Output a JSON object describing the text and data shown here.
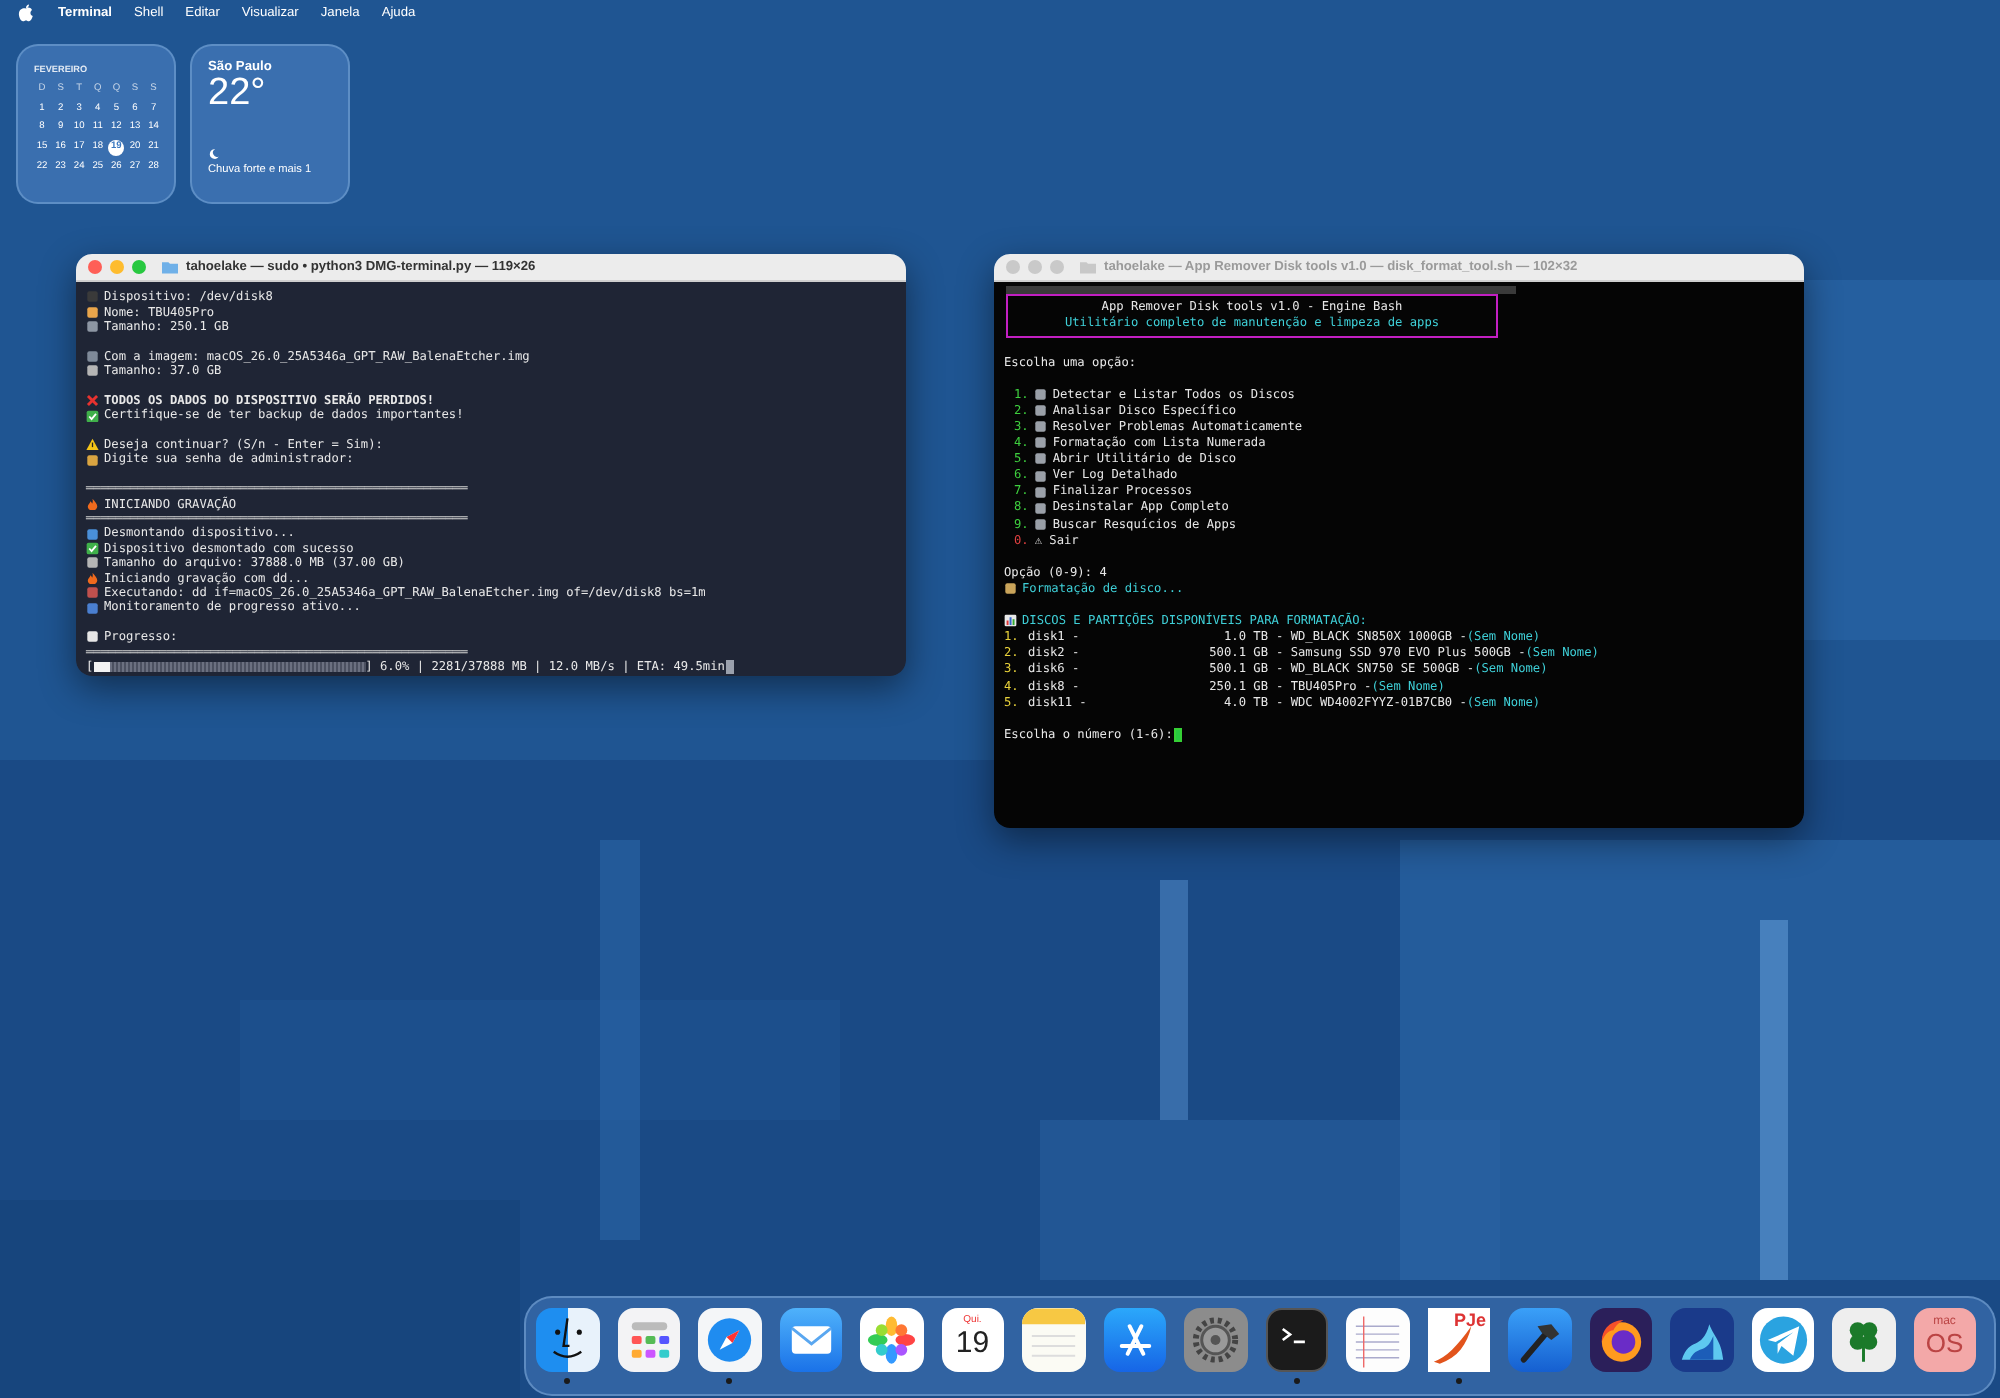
{
  "menu_bar": {
    "items": [
      {
        "label": "Terminal",
        "kind": "app"
      },
      {
        "label": "Shell",
        "kind": "menu"
      },
      {
        "label": "Editar",
        "kind": "menu"
      },
      {
        "label": "Visualizar",
        "kind": "menu"
      },
      {
        "label": "Janela",
        "kind": "menu"
      },
      {
        "label": "Ajuda",
        "kind": "menu"
      }
    ]
  },
  "calendar_widget": {
    "month": "FEVEREIRO",
    "weekdays": [
      "D",
      "S",
      "T",
      "Q",
      "Q",
      "S",
      "S"
    ],
    "weeks": [
      [
        {
          "day": "1",
          "selected": false
        },
        {
          "day": "2",
          "selected": false
        },
        {
          "day": "3",
          "selected": false
        },
        {
          "day": "4",
          "selected": false
        },
        {
          "day": "5",
          "selected": false
        },
        {
          "day": "6",
          "selected": false
        },
        {
          "day": "7",
          "selected": false
        }
      ],
      [
        {
          "day": "8",
          "selected": false
        },
        {
          "day": "9",
          "selected": false
        },
        {
          "day": "10",
          "selected": false
        },
        {
          "day": "11",
          "selected": false
        },
        {
          "day": "12",
          "selected": false
        },
        {
          "day": "13",
          "selected": false
        },
        {
          "day": "14",
          "selected": false
        }
      ],
      [
        {
          "day": "15",
          "selected": false
        },
        {
          "day": "16",
          "selected": false
        },
        {
          "day": "17",
          "selected": false
        },
        {
          "day": "18",
          "selected": false
        },
        {
          "day": "19",
          "selected": true
        },
        {
          "day": "20",
          "selected": false
        },
        {
          "day": "21",
          "selected": false
        }
      ],
      [
        {
          "day": "22",
          "selected": false
        },
        {
          "day": "23",
          "selected": false
        },
        {
          "day": "24",
          "selected": false
        },
        {
          "day": "25",
          "selected": false
        },
        {
          "day": "26",
          "selected": false
        },
        {
          "day": "27",
          "selected": false
        },
        {
          "day": "28",
          "selected": false
        }
      ]
    ]
  },
  "weather_widget": {
    "city": "São Paulo",
    "temperature": "22°",
    "condition": "Chuva forte e mais 1"
  },
  "dmg_terminal": {
    "title": "tahoelake — sudo • python3 DMG-terminal.py — 119×26",
    "active": true,
    "lines": [
      {
        "kind": "icon",
        "color": "#3a3a3a",
        "text": "Dispositivo: /dev/disk8"
      },
      {
        "kind": "icon",
        "color": "#e9a54b",
        "text": "Nome: TBU405Pro"
      },
      {
        "kind": "icon",
        "color": "#8d96a3",
        "text": "Tamanho: 250.1 GB"
      },
      {
        "kind": "blank"
      },
      {
        "kind": "icon",
        "color": "#7f8a99",
        "text": "Com a imagem: macOS_26.0_25A5346a_GPT_RAW_BalenaEtcher.img"
      },
      {
        "kind": "icon",
        "color": "#b5b5b5",
        "text": "Tamanho: 37.0 GB"
      },
      {
        "kind": "blank"
      },
      {
        "kind": "cross",
        "text": "TODOS OS DADOS DO DISPOSITIVO SERÃO PERDIDOS!"
      },
      {
        "kind": "check",
        "text": "Certifique-se de ter backup de dados importantes!"
      },
      {
        "kind": "blank"
      },
      {
        "kind": "warn",
        "text": "Deseja continuar? (S/n - Enter = Sim):"
      },
      {
        "kind": "icon",
        "color": "#d9a441",
        "text": "Digite sua senha de administrador:"
      },
      {
        "kind": "blank"
      },
      {
        "kind": "rule",
        "text": "════════════════════════════════════════════════════"
      },
      {
        "kind": "fire",
        "text": "INICIANDO GRAVAÇÃO"
      },
      {
        "kind": "rule",
        "text": "════════════════════════════════════════════════════"
      },
      {
        "kind": "icon",
        "color": "#4a8fd8",
        "text": "Desmontando dispositivo..."
      },
      {
        "kind": "check",
        "text": "Dispositivo desmontado com sucesso"
      },
      {
        "kind": "icon",
        "color": "#b5b5b5",
        "text": "Tamanho do arquivo: 37888.0 MB (37.00 GB)"
      },
      {
        "kind": "fire",
        "text": "Iniciando gravação com dd..."
      },
      {
        "kind": "icon",
        "color": "#c0504d",
        "text": "Executando: dd if=macOS_26.0_25A5346a_GPT_RAW_BalenaEtcher.img of=/dev/disk8 bs=1m"
      },
      {
        "kind": "icon",
        "color": "#4a7fd0",
        "text": "Monitoramento de progresso ativo..."
      },
      {
        "kind": "blank"
      },
      {
        "kind": "icon",
        "color": "#e6e6e6",
        "text": "Progresso:"
      },
      {
        "kind": "rule",
        "text": "════════════════════════════════════════════════════"
      },
      {
        "kind": "progress",
        "open": "[",
        "level": 0.06,
        "text": "] 6.0% | 2281/37888 MB | 12.0 MB/s | ETA: 49.5min"
      }
    ]
  },
  "disk_tool_terminal": {
    "title": "tahoelake — App Remover Disk tools v1.0 — disk_format_tool.sh — 102×32",
    "active": false,
    "banner": {
      "title": "App Remover Disk tools v1.0 - Engine Bash",
      "subtitle": "Utilitário completo de manutenção e limpeza de apps"
    },
    "prompt": "Escolha uma opção:",
    "options": [
      {
        "number": "1.",
        "label": "Detectar e Listar Todos os Discos",
        "color": "#3ecf3e",
        "kind": "emoji"
      },
      {
        "number": "2.",
        "label": "Analisar Disco Específico",
        "color": "#3ecf3e",
        "kind": "emoji"
      },
      {
        "number": "3.",
        "label": "Resolver Problemas Automaticamente",
        "color": "#3ecf3e",
        "kind": "emoji"
      },
      {
        "number": "4.",
        "label": "Formatação com Lista Numerada",
        "color": "#3ecf3e",
        "kind": "emoji"
      },
      {
        "number": "5.",
        "label": "Abrir Utilitário de Disco",
        "color": "#3ecf3e",
        "kind": "emoji"
      },
      {
        "number": "6.",
        "label": "Ver Log Detalhado",
        "color": "#3ecf3e",
        "kind": "emoji"
      },
      {
        "number": "7.",
        "label": "Finalizar Processos",
        "color": "#3ecf3e",
        "kind": "emoji"
      },
      {
        "number": "8.",
        "label": "Desinstalar App Completo",
        "color": "#3ecf3e",
        "kind": "emoji"
      },
      {
        "number": "9.",
        "label": "Buscar Resquícios de Apps",
        "color": "#3ecf3e",
        "kind": "emoji"
      },
      {
        "number": "0.",
        "label": "⚠ Sair",
        "color": "#e04040",
        "kind": "text"
      }
    ],
    "answer": "Opção (0-9): 4",
    "status": "Formatação de disco...",
    "heading": "DISCOS E PARTIÇÕES DISPONÍVEIS PARA FORMATAÇÃO:",
    "disks": [
      {
        "number": "1.",
        "name": "disk1 -",
        "size": "1.0 TB",
        "model": "- WD_BLACK SN850X 1000GB -",
        "label": "(Sem Nome)"
      },
      {
        "number": "2.",
        "name": "disk2 -",
        "size": "500.1 GB",
        "model": "- Samsung SSD 970 EVO Plus 500GB -",
        "label": "(Sem Nome)"
      },
      {
        "number": "3.",
        "name": "disk6 -",
        "size": "500.1 GB",
        "model": "- WD_BLACK SN750 SE 500GB -",
        "label": "(Sem Nome)"
      },
      {
        "number": "4.",
        "name": "disk8 -",
        "size": "250.1 GB",
        "model": "- TBU405Pro -",
        "label": "(Sem Nome)"
      },
      {
        "number": "5.",
        "name": "disk11 -",
        "size": "4.0 TB",
        "model": "- WDC WD4002FYYZ-01B7CB0 -",
        "label": "(Sem Nome)"
      }
    ],
    "input_prompt": "Escolha o número (1-6):"
  },
  "dock": {
    "items": [
      {
        "kind": "finder",
        "running": true
      },
      {
        "kind": "launchpad",
        "running": false
      },
      {
        "kind": "safari",
        "running": true
      },
      {
        "kind": "mail",
        "running": false
      },
      {
        "kind": "photos",
        "running": false
      },
      {
        "kind": "calendar",
        "running": false,
        "label": "Qui.",
        "value": "19"
      },
      {
        "kind": "notes",
        "running": false
      },
      {
        "kind": "appstore",
        "running": false
      },
      {
        "kind": "settings",
        "running": false
      },
      {
        "kind": "terminal",
        "running": true
      },
      {
        "kind": "textedit",
        "running": false
      },
      {
        "kind": "pje",
        "running": true,
        "label": "PJe"
      },
      {
        "kind": "xcode",
        "running": false
      },
      {
        "kind": "firefox",
        "running": false
      },
      {
        "kind": "wave",
        "running": false
      },
      {
        "kind": "telegram",
        "running": false
      },
      {
        "kind": "clover",
        "running": false
      },
      {
        "kind": "macos",
        "running": false,
        "label": "mac",
        "value": "OS"
      }
    ]
  }
}
